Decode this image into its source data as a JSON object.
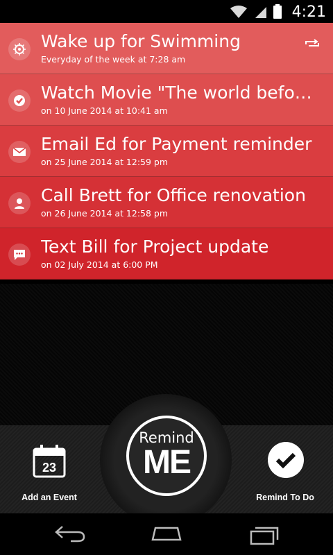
{
  "status_bar": {
    "time": "4:21"
  },
  "reminders": [
    {
      "title": "Wake up for Swimming",
      "subtitle": "Everyday of the week at 7:28 am",
      "icon": "alarm-icon",
      "color": "#e25c5c"
    },
    {
      "title": "Watch Movie \"The world before h…",
      "subtitle": "on 10 June 2014 at 10:41 am",
      "icon": "check-icon",
      "color": "#de4e4f"
    },
    {
      "title": "Email Ed for Payment reminder",
      "subtitle": "on 25 June 2014 at 12:59 pm",
      "icon": "mail-icon",
      "color": "#da3d40"
    },
    {
      "title": "Call Brett for Office renovation",
      "subtitle": "on 26 June 2014 at 12:58 pm",
      "icon": "contact-icon",
      "color": "#d53136"
    },
    {
      "title": "Text Bill for Project update",
      "subtitle": "on 02 July 2014 at 6:00 PM",
      "icon": "message-icon",
      "color": "#d0242b"
    }
  ],
  "bottom": {
    "add_event": {
      "label": "Add an Event",
      "calendar_day": "23"
    },
    "remind_me": {
      "top": "Remind",
      "bottom": "ME"
    },
    "remind_todo": {
      "label": "Remind To Do"
    }
  }
}
